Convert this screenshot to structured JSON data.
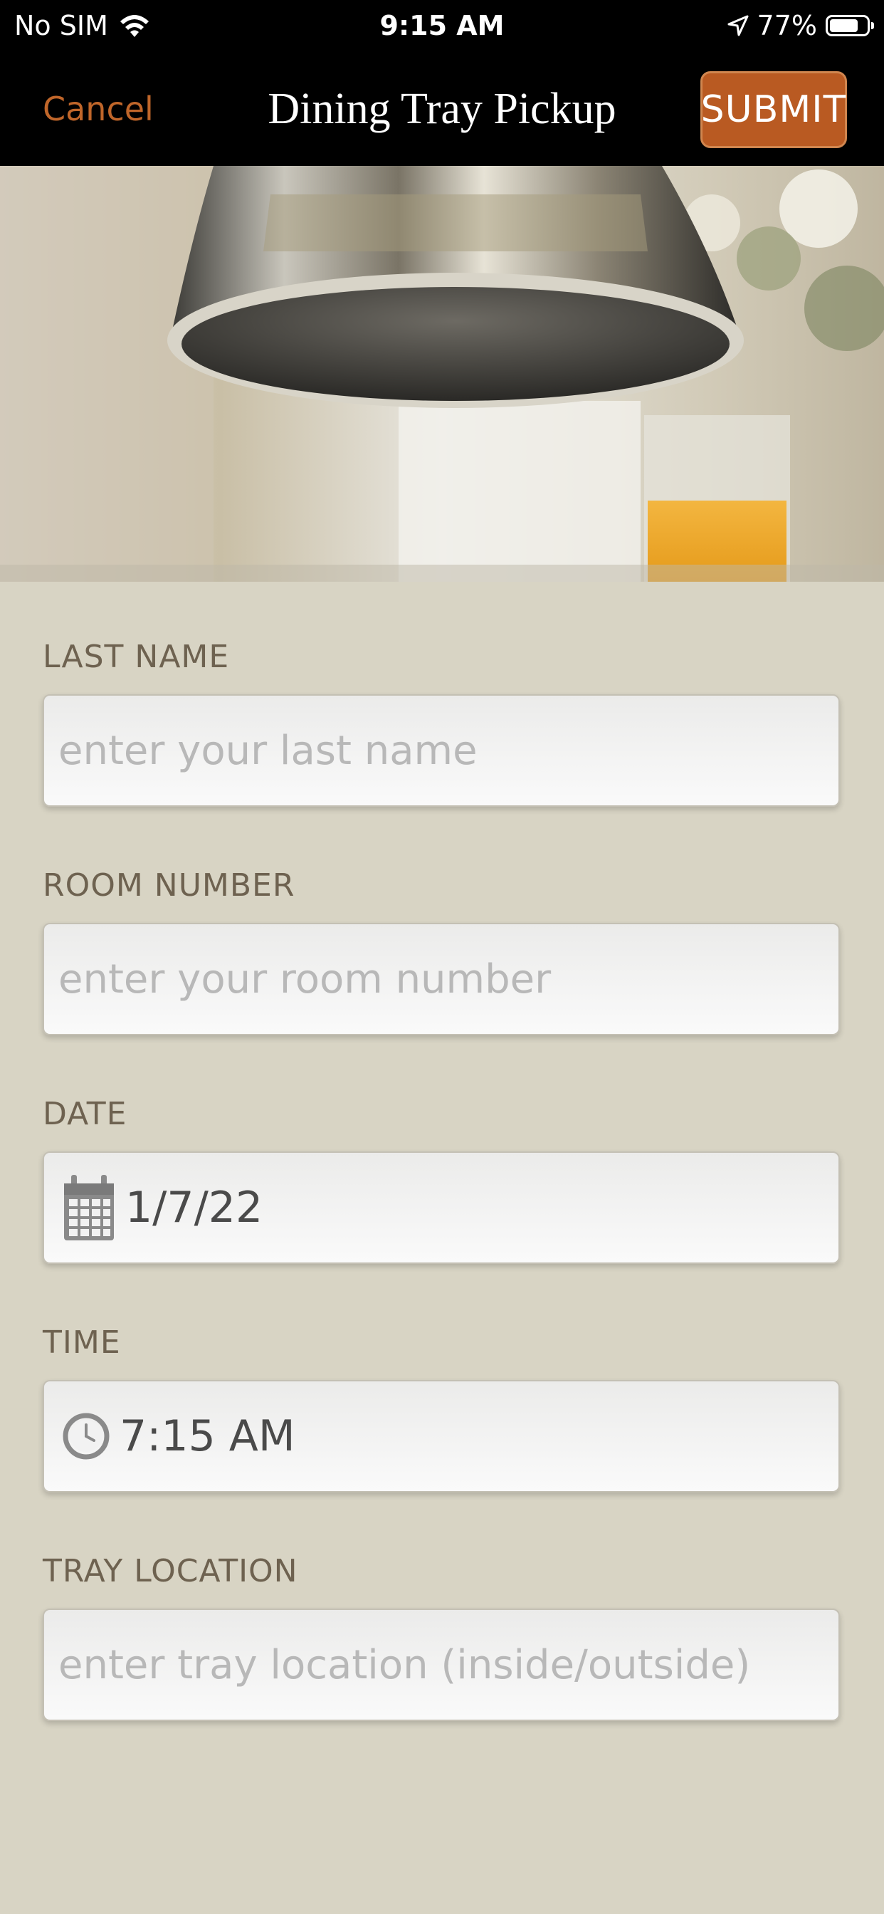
{
  "status_bar": {
    "carrier": "No SIM",
    "time": "9:15 AM",
    "battery_percent": "77%",
    "battery_level": 0.77,
    "icons": [
      "wifi-icon",
      "location-arrow-icon",
      "battery-icon"
    ]
  },
  "nav": {
    "cancel_label": "Cancel",
    "title": "Dining Tray Pickup",
    "submit_label": "SUBMIT"
  },
  "colors": {
    "accent": "#c0662a",
    "submit_bg": "#b95a22",
    "page_bg": "#d8d4c4",
    "label": "#6e6250"
  },
  "form": {
    "last_name": {
      "label": "LAST NAME",
      "value": "",
      "placeholder": "enter your last name"
    },
    "room_number": {
      "label": "ROOM NUMBER",
      "value": "",
      "placeholder": "enter your room number"
    },
    "date": {
      "label": "DATE",
      "value": "1/7/22",
      "icon": "calendar-icon"
    },
    "time": {
      "label": "TIME",
      "value": "7:15 AM",
      "icon": "clock-icon"
    },
    "tray_location": {
      "label": "TRAY LOCATION",
      "value": "",
      "placeholder": "enter tray location (inside/outside)"
    }
  }
}
